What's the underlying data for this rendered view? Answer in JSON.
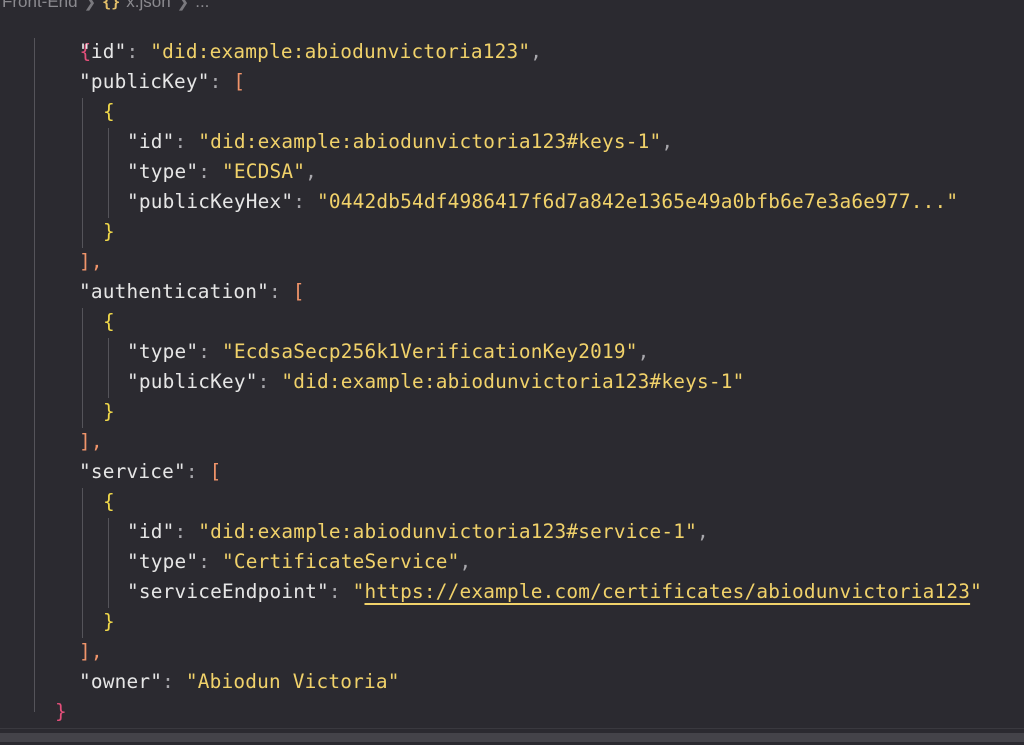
{
  "breadcrumb": {
    "folder": "Front-End",
    "icon": "{}",
    "file": "x.json",
    "more": "..."
  },
  "code": {
    "open_root": "{",
    "close_root": "}",
    "open_obj": "{",
    "close_obj": "}",
    "open_arr": "[",
    "close_arr": "],",
    "keys": {
      "id": "\"id\"",
      "publicKey": "\"publicKey\"",
      "type": "\"type\"",
      "publicKeyHex": "\"publicKeyHex\"",
      "authentication": "\"authentication\"",
      "service": "\"service\"",
      "serviceEndpoint": "\"serviceEndpoint\"",
      "owner": "\"owner\""
    },
    "values": {
      "root_id": "\"did:example:abiodunvictoria123\"",
      "key_id": "\"did:example:abiodunvictoria123#keys-1\"",
      "key_type": "\"ECDSA\"",
      "key_hex": "\"0442db54df4986417f6d7a842e1365e49a0bfb6e7e3a6e977...\"",
      "auth_type": "\"EcdsaSecp256k1VerificationKey2019\"",
      "auth_key": "\"did:example:abiodunvictoria123#keys-1\"",
      "svc_id": "\"did:example:abiodunvictoria123#service-1\"",
      "svc_type": "\"CertificateService\"",
      "svc_endpoint_q1": "\"",
      "svc_endpoint_url": "https://example.com/certificates/abiodunvictoria123",
      "svc_endpoint_q2": "\"",
      "owner": "\"Abiodun Victoria\""
    },
    "colon": ": ",
    "comma": ","
  }
}
